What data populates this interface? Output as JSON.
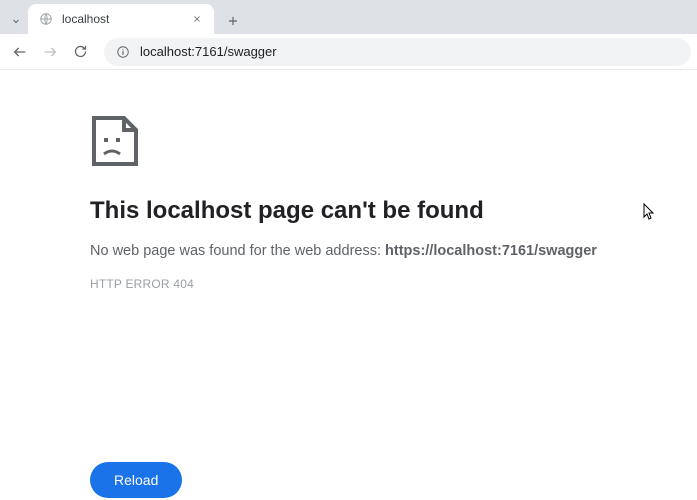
{
  "tab": {
    "title": "localhost"
  },
  "omnibox": {
    "url": "localhost:7161/swagger"
  },
  "error": {
    "title": "This localhost page can't be found",
    "description_prefix": "No web page was found for the web address: ",
    "description_url": "https://localhost:7161/swagger",
    "code": "HTTP ERROR 404",
    "reload_label": "Reload"
  }
}
